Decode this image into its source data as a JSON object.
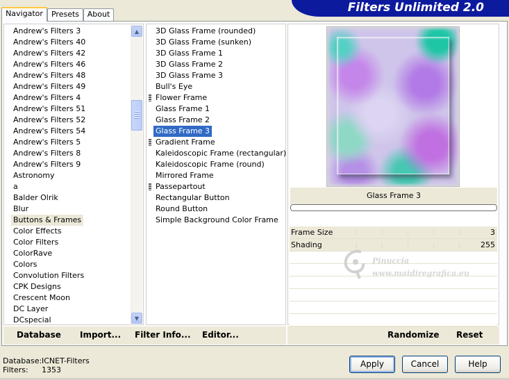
{
  "window": {
    "title": "Filters Unlimited 2.0"
  },
  "tabs": [
    {
      "label": "Navigator",
      "active": true
    },
    {
      "label": "Presets",
      "active": false
    },
    {
      "label": "About",
      "active": false
    }
  ],
  "categories": {
    "items": [
      "Andrew's Filters 3",
      "Andrew's Filters 40",
      "Andrew's Filters 42",
      "Andrew's Filters 46",
      "Andrew's Filters 48",
      "Andrew's Filters 49",
      "Andrew's Filters 4",
      "Andrew's Filters 51",
      "Andrew's Filters 52",
      "Andrew's Filters 54",
      "Andrew's Filters 5",
      "Andrew's Filters 8",
      "Andrew's Filters 9",
      "Astronomy",
      "a",
      "Balder Olrik",
      "Blur",
      "Buttons & Frames",
      "Color Effects",
      "Color Filters",
      "ColorRave",
      "Colors",
      "Convolution Filters",
      "CPK Designs",
      "Crescent Moon",
      "DC Layer",
      "DCspecial"
    ],
    "selected": "Buttons & Frames"
  },
  "filters": {
    "items": [
      {
        "label": "3D Glass Frame (rounded)",
        "grip": false
      },
      {
        "label": "3D Glass Frame (sunken)",
        "grip": false
      },
      {
        "label": "3D Glass Frame 1",
        "grip": false
      },
      {
        "label": "3D Glass Frame 2",
        "grip": false
      },
      {
        "label": "3D Glass Frame 3",
        "grip": false
      },
      {
        "label": "Bull's Eye",
        "grip": false
      },
      {
        "label": "Flower Frame",
        "grip": true
      },
      {
        "label": "Glass Frame 1",
        "grip": false
      },
      {
        "label": "Glass Frame 2",
        "grip": false
      },
      {
        "label": "Glass Frame 3",
        "grip": false
      },
      {
        "label": "Gradient Frame",
        "grip": true
      },
      {
        "label": "Kaleidoscopic Frame (rectangular)",
        "grip": false
      },
      {
        "label": "Kaleidoscopic Frame (round)",
        "grip": false
      },
      {
        "label": "Mirrored Frame",
        "grip": false
      },
      {
        "label": "Passepartout",
        "grip": true
      },
      {
        "label": "Rectangular Button",
        "grip": false
      },
      {
        "label": "Round Button",
        "grip": false
      },
      {
        "label": "Simple Background Color Frame",
        "grip": false
      }
    ],
    "selected": "Glass Frame 3"
  },
  "left_toolbar": {
    "database": "Database",
    "import": "Import...",
    "filter_info": "Filter Info...",
    "editor": "Editor..."
  },
  "preview": {
    "filter_name": "Glass Frame 3",
    "progress": 0
  },
  "parameters": [
    {
      "label": "Frame Size",
      "value": "3"
    },
    {
      "label": "Shading",
      "value": "255"
    }
  ],
  "right_toolbar": {
    "randomize": "Randomize",
    "reset": "Reset"
  },
  "watermark": {
    "name": "Pinuccia",
    "url": "www.maidiregrafica.eu"
  },
  "status": {
    "database_label": "Database:",
    "database_value": "ICNET-Filters",
    "filters_label": "Filters:",
    "filters_value": "1353"
  },
  "buttons": {
    "apply": "Apply",
    "cancel": "Cancel",
    "help": "Help"
  },
  "colors": {
    "title_bar": "#0c1a9e",
    "selection_blue": "#316ac5",
    "window_bg": "#ece9d8"
  }
}
